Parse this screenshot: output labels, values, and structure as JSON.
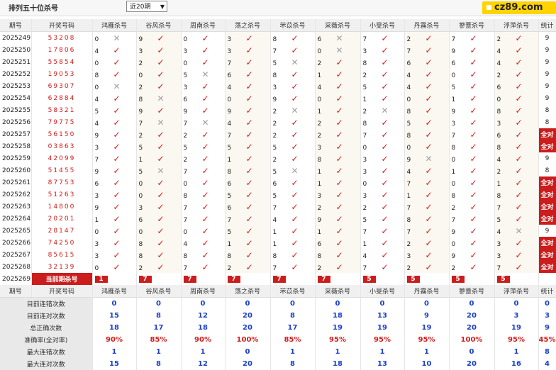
{
  "page": {
    "title": "排列五十位杀号",
    "range_select": "近20期",
    "logo_text": "cz89.com"
  },
  "columns": [
    "期号",
    "开奖号码",
    "鸿雁杀号",
    "谷风杀号",
    "周南杀号",
    "荡之杀号",
    "芣苡杀号",
    "采薇杀号",
    "小旻杀号",
    "丹霧杀号",
    "蓼薏杀号",
    "浮萍杀号",
    "统计"
  ],
  "rows": [
    {
      "period": "2025249",
      "number": "53208",
      "vals": [
        "0",
        "9",
        "0",
        "3",
        "8",
        "6",
        "7",
        "2",
        "7",
        "2"
      ],
      "marks": [
        "x",
        "v",
        "v",
        "v",
        "v",
        "x",
        "v",
        "v",
        "v",
        "v"
      ],
      "total": "9"
    },
    {
      "period": "2025250",
      "number": "17806",
      "vals": [
        "4",
        "3",
        "3",
        "3",
        "7",
        "0",
        "3",
        "7",
        "9",
        "4"
      ],
      "marks": [
        "v",
        "v",
        "v",
        "v",
        "v",
        "x",
        "v",
        "v",
        "v",
        "v"
      ],
      "total": "9"
    },
    {
      "period": "2025251",
      "number": "55854",
      "vals": [
        "0",
        "2",
        "0",
        "7",
        "5",
        "2",
        "8",
        "6",
        "6",
        "4"
      ],
      "marks": [
        "v",
        "v",
        "v",
        "v",
        "x",
        "v",
        "v",
        "v",
        "v",
        "v"
      ],
      "total": "9"
    },
    {
      "period": "2025252",
      "number": "19053",
      "vals": [
        "8",
        "0",
        "5",
        "6",
        "8",
        "1",
        "2",
        "4",
        "0",
        "2"
      ],
      "marks": [
        "v",
        "v",
        "x",
        "v",
        "v",
        "v",
        "v",
        "v",
        "v",
        "v"
      ],
      "total": "9"
    },
    {
      "period": "2025253",
      "number": "69307",
      "vals": [
        "0",
        "2",
        "3",
        "4",
        "3",
        "4",
        "5",
        "4",
        "5",
        "6"
      ],
      "marks": [
        "x",
        "v",
        "v",
        "v",
        "v",
        "v",
        "v",
        "v",
        "v",
        "v"
      ],
      "total": "9"
    },
    {
      "period": "2025254",
      "number": "62884",
      "vals": [
        "4",
        "8",
        "6",
        "0",
        "9",
        "0",
        "1",
        "0",
        "1",
        "0"
      ],
      "marks": [
        "v",
        "x",
        "v",
        "v",
        "v",
        "v",
        "v",
        "v",
        "v",
        "v"
      ],
      "total": "9"
    },
    {
      "period": "2025255",
      "number": "58321",
      "vals": [
        "5",
        "9",
        "9",
        "9",
        "2",
        "1",
        "2",
        "8",
        "9",
        "8"
      ],
      "marks": [
        "v",
        "v",
        "v",
        "v",
        "x",
        "v",
        "x",
        "v",
        "v",
        "v"
      ],
      "total": "8"
    },
    {
      "period": "2025256",
      "number": "79775",
      "vals": [
        "4",
        "7",
        "7",
        "4",
        "2",
        "2",
        "8",
        "5",
        "3",
        "3"
      ],
      "marks": [
        "v",
        "x",
        "x",
        "v",
        "v",
        "v",
        "v",
        "v",
        "v",
        "v"
      ],
      "total": "8"
    },
    {
      "period": "2025257",
      "number": "56150",
      "vals": [
        "9",
        "2",
        "2",
        "7",
        "2",
        "2",
        "7",
        "8",
        "7",
        "6"
      ],
      "marks": [
        "v",
        "v",
        "v",
        "v",
        "v",
        "v",
        "v",
        "v",
        "v",
        "v"
      ],
      "total": "全对"
    },
    {
      "period": "2025258",
      "number": "03863",
      "vals": [
        "3",
        "5",
        "5",
        "5",
        "5",
        "3",
        "0",
        "0",
        "8",
        "8"
      ],
      "marks": [
        "v",
        "v",
        "v",
        "v",
        "v",
        "v",
        "v",
        "v",
        "v",
        "v"
      ],
      "total": "全对"
    },
    {
      "period": "2025259",
      "number": "42099",
      "vals": [
        "7",
        "1",
        "2",
        "1",
        "2",
        "8",
        "3",
        "9",
        "0",
        "4"
      ],
      "marks": [
        "v",
        "v",
        "v",
        "v",
        "v",
        "v",
        "v",
        "x",
        "v",
        "v"
      ],
      "total": "9"
    },
    {
      "period": "2025260",
      "number": "51455",
      "vals": [
        "9",
        "5",
        "7",
        "8",
        "5",
        "1",
        "3",
        "4",
        "1",
        "2"
      ],
      "marks": [
        "v",
        "x",
        "v",
        "v",
        "x",
        "v",
        "v",
        "v",
        "v",
        "v"
      ],
      "total": "8"
    },
    {
      "period": "2025261",
      "number": "87753",
      "vals": [
        "6",
        "0",
        "0",
        "6",
        "6",
        "1",
        "0",
        "7",
        "0",
        "1"
      ],
      "marks": [
        "v",
        "v",
        "v",
        "v",
        "v",
        "v",
        "v",
        "v",
        "v",
        "v"
      ],
      "total": "全对"
    },
    {
      "period": "2025262",
      "number": "51263",
      "vals": [
        "3",
        "0",
        "8",
        "5",
        "5",
        "3",
        "3",
        "1",
        "8",
        "8"
      ],
      "marks": [
        "v",
        "v",
        "v",
        "v",
        "v",
        "v",
        "v",
        "v",
        "v",
        "v"
      ],
      "total": "全对"
    },
    {
      "period": "2025263",
      "number": "14800",
      "vals": [
        "9",
        "3",
        "7",
        "6",
        "7",
        "2",
        "2",
        "7",
        "2",
        "7"
      ],
      "marks": [
        "v",
        "v",
        "v",
        "v",
        "v",
        "v",
        "v",
        "v",
        "v",
        "v"
      ],
      "total": "全对"
    },
    {
      "period": "2025264",
      "number": "20201",
      "vals": [
        "1",
        "6",
        "7",
        "7",
        "4",
        "9",
        "5",
        "8",
        "7",
        "5"
      ],
      "marks": [
        "v",
        "v",
        "v",
        "v",
        "v",
        "v",
        "v",
        "v",
        "v",
        "v"
      ],
      "total": "全对"
    },
    {
      "period": "2025265",
      "number": "28147",
      "vals": [
        "0",
        "0",
        "0",
        "5",
        "1",
        "1",
        "7",
        "7",
        "9",
        "4"
      ],
      "marks": [
        "v",
        "v",
        "v",
        "v",
        "v",
        "v",
        "v",
        "v",
        "v",
        "x"
      ],
      "total": "9"
    },
    {
      "period": "2025266",
      "number": "74250",
      "vals": [
        "3",
        "8",
        "4",
        "1",
        "1",
        "6",
        "1",
        "2",
        "0",
        "3"
      ],
      "marks": [
        "v",
        "v",
        "v",
        "v",
        "v",
        "v",
        "v",
        "v",
        "v",
        "v"
      ],
      "total": "全对"
    },
    {
      "period": "2025267",
      "number": "85615",
      "vals": [
        "3",
        "8",
        "8",
        "8",
        "8",
        "8",
        "4",
        "3",
        "9",
        "3"
      ],
      "marks": [
        "v",
        "v",
        "v",
        "v",
        "v",
        "v",
        "v",
        "v",
        "v",
        "v"
      ],
      "total": "全对"
    },
    {
      "period": "2025268",
      "number": "32139",
      "vals": [
        "0",
        "2",
        "7",
        "2",
        "7",
        "2",
        "7",
        "2",
        "2",
        "7"
      ],
      "marks": [
        "v",
        "v",
        "v",
        "v",
        "v",
        "v",
        "v",
        "v",
        "v",
        "v"
      ],
      "total": "全对"
    }
  ],
  "current": {
    "period": "2025269",
    "label": "当前期杀号",
    "vals": [
      "1",
      "7",
      "7",
      "7",
      "7",
      "7",
      "5",
      "5",
      "5",
      "5"
    ]
  },
  "stats": [
    {
      "label": "目前连错次数",
      "vals": [
        "0",
        "0",
        "0",
        "0",
        "0",
        "0",
        "0",
        "0",
        "0",
        "0",
        "0"
      ],
      "pct": false
    },
    {
      "label": "目前连对次数",
      "vals": [
        "15",
        "8",
        "12",
        "20",
        "8",
        "18",
        "13",
        "9",
        "20",
        "3",
        "3"
      ],
      "pct": false
    },
    {
      "label": "总正确次数",
      "vals": [
        "18",
        "17",
        "18",
        "20",
        "17",
        "19",
        "19",
        "19",
        "20",
        "19",
        "9"
      ],
      "pct": false
    },
    {
      "label": "准确率(全对率)",
      "vals": [
        "90%",
        "85%",
        "90%",
        "100%",
        "85%",
        "95%",
        "95%",
        "95%",
        "100%",
        "95%",
        "45%"
      ],
      "pct": true
    },
    {
      "label": "最大连错次数",
      "vals": [
        "1",
        "1",
        "1",
        "0",
        "1",
        "1",
        "1",
        "1",
        "0",
        "1",
        "8"
      ],
      "pct": false
    },
    {
      "label": "最大连对次数",
      "vals": [
        "15",
        "8",
        "12",
        "20",
        "8",
        "18",
        "13",
        "10",
        "20",
        "16",
        "4"
      ],
      "pct": false
    }
  ],
  "icons": {
    "check": "check-icon",
    "cross": "cross-icon"
  },
  "colors": {
    "accent_red": "#cc1d1d",
    "stat_blue": "#1a3fcc",
    "logo_yellow": "#ffd400"
  }
}
